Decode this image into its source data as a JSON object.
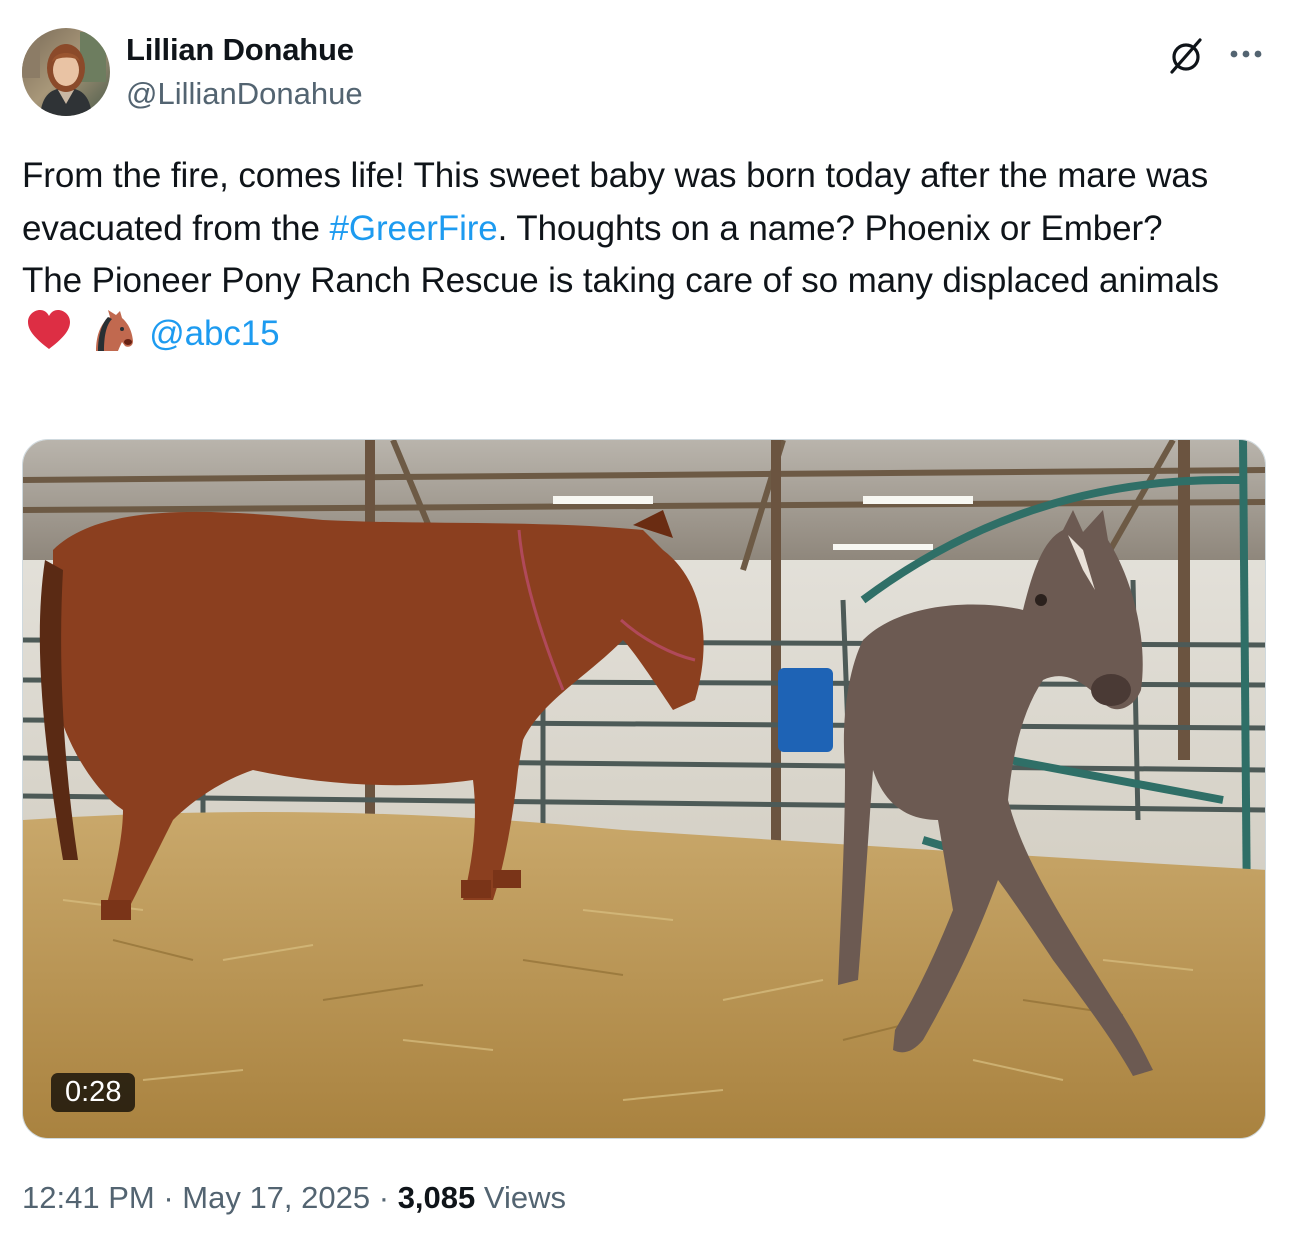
{
  "author": {
    "name": "Lillian Donahue",
    "handle": "@LillianDonahue"
  },
  "icons": {
    "grok": "grok-slash-icon",
    "more": "more-dots-icon",
    "heart": "red-heart-emoji",
    "horse": "horse-face-emoji"
  },
  "tweet": {
    "part1": "From the fire, comes life! This sweet baby was born today after the mare was evacuated from the ",
    "hashtag": "#GreerFire",
    "part2": ". Thoughts on a name? Phoenix or Ember?",
    "line2": "The Pioneer Pony Ranch Rescue is taking care of so many displaced animals",
    "mention": "@abc15"
  },
  "media": {
    "duration": "0:28",
    "description_icon": "video-thumbnail"
  },
  "meta": {
    "time": "12:41 PM",
    "sep1": " · ",
    "date": "May 17, 2025",
    "sep2": " · ",
    "views_count": "3,085",
    "views_label": " Views"
  },
  "colors": {
    "link": "#1d9bf0",
    "text": "#0f1419",
    "secondary": "#536471"
  }
}
